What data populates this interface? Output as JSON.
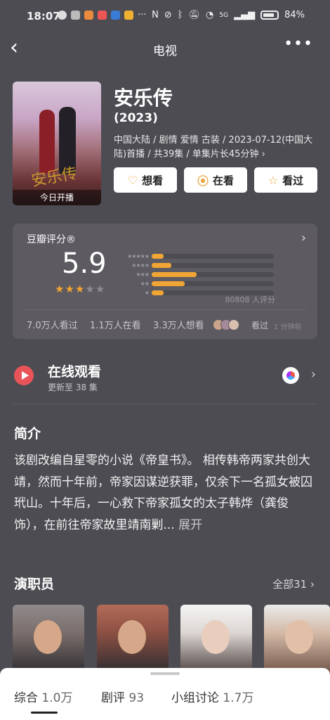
{
  "status_bar": {
    "time": "18:07",
    "battery": "84%",
    "network": "5G"
  },
  "nav": {
    "back": "‹",
    "title": "电视",
    "more": "•••"
  },
  "show": {
    "title": "安乐传",
    "year": "(2023)",
    "meta": "中国大陆 / 剧情 爱情 古装 / 2023-07-12(中国大陆)首播 / 共39集 / 单集片长45分钟 ›",
    "poster_title": "安乐传",
    "poster_badge": "今日开播"
  },
  "actions": {
    "want": "想看",
    "watching": "在看",
    "watched": "看过"
  },
  "rating": {
    "label": "豆瓣评分®",
    "score": "5.9",
    "stars_on": 3,
    "stars_total": 5,
    "distribution": [
      {
        "stars": "★★★★★",
        "pct": 0.1
      },
      {
        "stars": "★★★★",
        "pct": 0.16
      },
      {
        "stars": "★★★",
        "pct": 0.37
      },
      {
        "stars": "★★",
        "pct": 0.27
      },
      {
        "stars": "★",
        "pct": 0.1
      }
    ],
    "count": "80808 人评分",
    "watched_count": "7.0万人看过",
    "watching_count": "1.1万人在看",
    "want_count": "3.3万人想看",
    "friend_seen": "看过",
    "friend_ago": "1 分钟前"
  },
  "watch": {
    "title": "在线观看",
    "subtitle": "更新至 38 集"
  },
  "intro": {
    "heading": "简介",
    "text": "该剧改编自星零的小说《帝皇书》。 相传韩帝两家共创大靖，然而十年前，帝家因谋逆获罪，仅余下一名孤女被囚玳山。十年后，一心救下帝家孤女的太子韩烨（龚俊 饰），在前往帝家故里靖南剿...",
    "expand": "展开"
  },
  "cast": {
    "heading": "演职员",
    "all": "全部31 ›"
  },
  "bottom_tabs": [
    {
      "label": "综合",
      "count": "1.0万"
    },
    {
      "label": "剧评",
      "count": "93"
    },
    {
      "label": "小组讨论",
      "count": "1.7万"
    }
  ],
  "colors": {
    "accent": "#f0a534",
    "background": "#4e4c53",
    "card": "#5d5a61",
    "play": "#e8545a"
  }
}
